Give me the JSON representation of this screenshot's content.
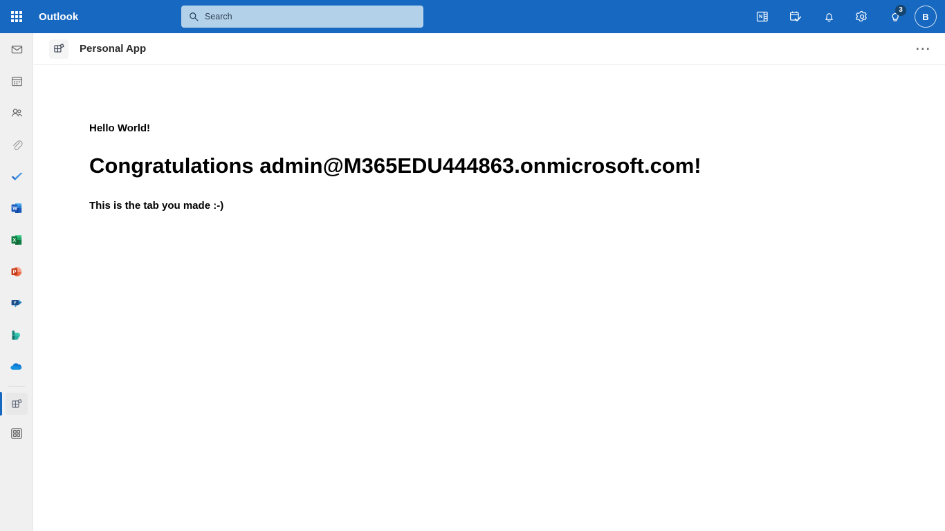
{
  "topbar": {
    "waffle_label": "app-launcher",
    "brand": "Outlook",
    "search": {
      "placeholder": "Search",
      "value": ""
    },
    "icons": [
      {
        "name": "onenote-feed-icon",
        "title": "OneNote feed"
      },
      {
        "name": "my-day-icon",
        "title": "My Day"
      },
      {
        "name": "notifications-bell-icon",
        "title": "Notifications"
      },
      {
        "name": "settings-gear-icon",
        "title": "Settings"
      },
      {
        "name": "help-lightbulb-icon",
        "title": "Help",
        "badge": "3"
      }
    ],
    "avatar_initial": "B",
    "accent_color": "#1668c1",
    "search_bg": "#b4d1ea",
    "badge_color": "#15446f"
  },
  "rail": {
    "items": [
      {
        "name": "sidebar-item-mail",
        "label": "Mail",
        "icon": "mail-icon",
        "selected": false
      },
      {
        "name": "sidebar-item-calendar",
        "label": "Calendar",
        "icon": "calendar-icon",
        "selected": false
      },
      {
        "name": "sidebar-item-people",
        "label": "People",
        "icon": "people-icon",
        "selected": false
      },
      {
        "name": "sidebar-item-files",
        "label": "Files",
        "icon": "paperclip-icon",
        "selected": false
      },
      {
        "name": "sidebar-item-todo",
        "label": "To Do",
        "icon": "todo-check-icon",
        "selected": false
      },
      {
        "name": "sidebar-item-word",
        "label": "Word",
        "icon": "word-icon",
        "selected": false
      },
      {
        "name": "sidebar-item-excel",
        "label": "Excel",
        "icon": "excel-icon",
        "selected": false
      },
      {
        "name": "sidebar-item-powerpoint",
        "label": "PowerPoint",
        "icon": "powerpoint-icon",
        "selected": false
      },
      {
        "name": "sidebar-item-yammer",
        "label": "Viva Engage",
        "icon": "yammer-icon",
        "selected": false
      },
      {
        "name": "sidebar-item-bookings",
        "label": "Bookings",
        "icon": "bookings-icon",
        "selected": false
      },
      {
        "name": "sidebar-item-onedrive",
        "label": "OneDrive",
        "icon": "onedrive-cloud-icon",
        "selected": false
      },
      {
        "name": "sidebar-item-personal-app",
        "label": "Personal App",
        "icon": "personal-app-icon",
        "selected": true
      },
      {
        "name": "sidebar-item-all-apps",
        "label": "All apps",
        "icon": "apps-grid-icon",
        "selected": false
      }
    ],
    "selection_color": "#1668c1"
  },
  "apphead": {
    "icon_name": "personal-app-icon",
    "title": "Personal App",
    "more_label": "···"
  },
  "main": {
    "greeting": "Hello World!",
    "congratulations": "Congratulations admin@M365EDU444863.onmicrosoft.com!",
    "subtext": "This is the tab you made :-)"
  }
}
